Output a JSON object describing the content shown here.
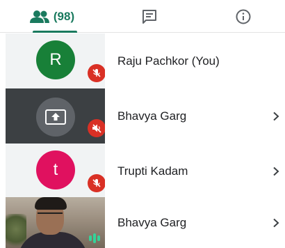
{
  "tabs": {
    "people_count": "(98)",
    "active_color": "#1a7a5e",
    "items": [
      {
        "name": "people",
        "icon": "people-icon"
      },
      {
        "name": "chat",
        "icon": "chat-icon"
      },
      {
        "name": "info",
        "icon": "info-icon"
      }
    ]
  },
  "participants": [
    {
      "name": "Raju Pachkor (You)",
      "avatar_letter": "R",
      "avatar_color": "#188038",
      "muted": true,
      "type": "avatar"
    },
    {
      "name": "Bhavya Garg",
      "type": "screen-share",
      "muted": true,
      "has_chevron": true
    },
    {
      "name": "Trupti Kadam",
      "avatar_letter": "t",
      "avatar_color": "#e0115f",
      "muted": true,
      "has_chevron": true,
      "type": "avatar"
    },
    {
      "name": "Bhavya Garg",
      "type": "video",
      "speaking": true,
      "has_chevron": true
    }
  ]
}
